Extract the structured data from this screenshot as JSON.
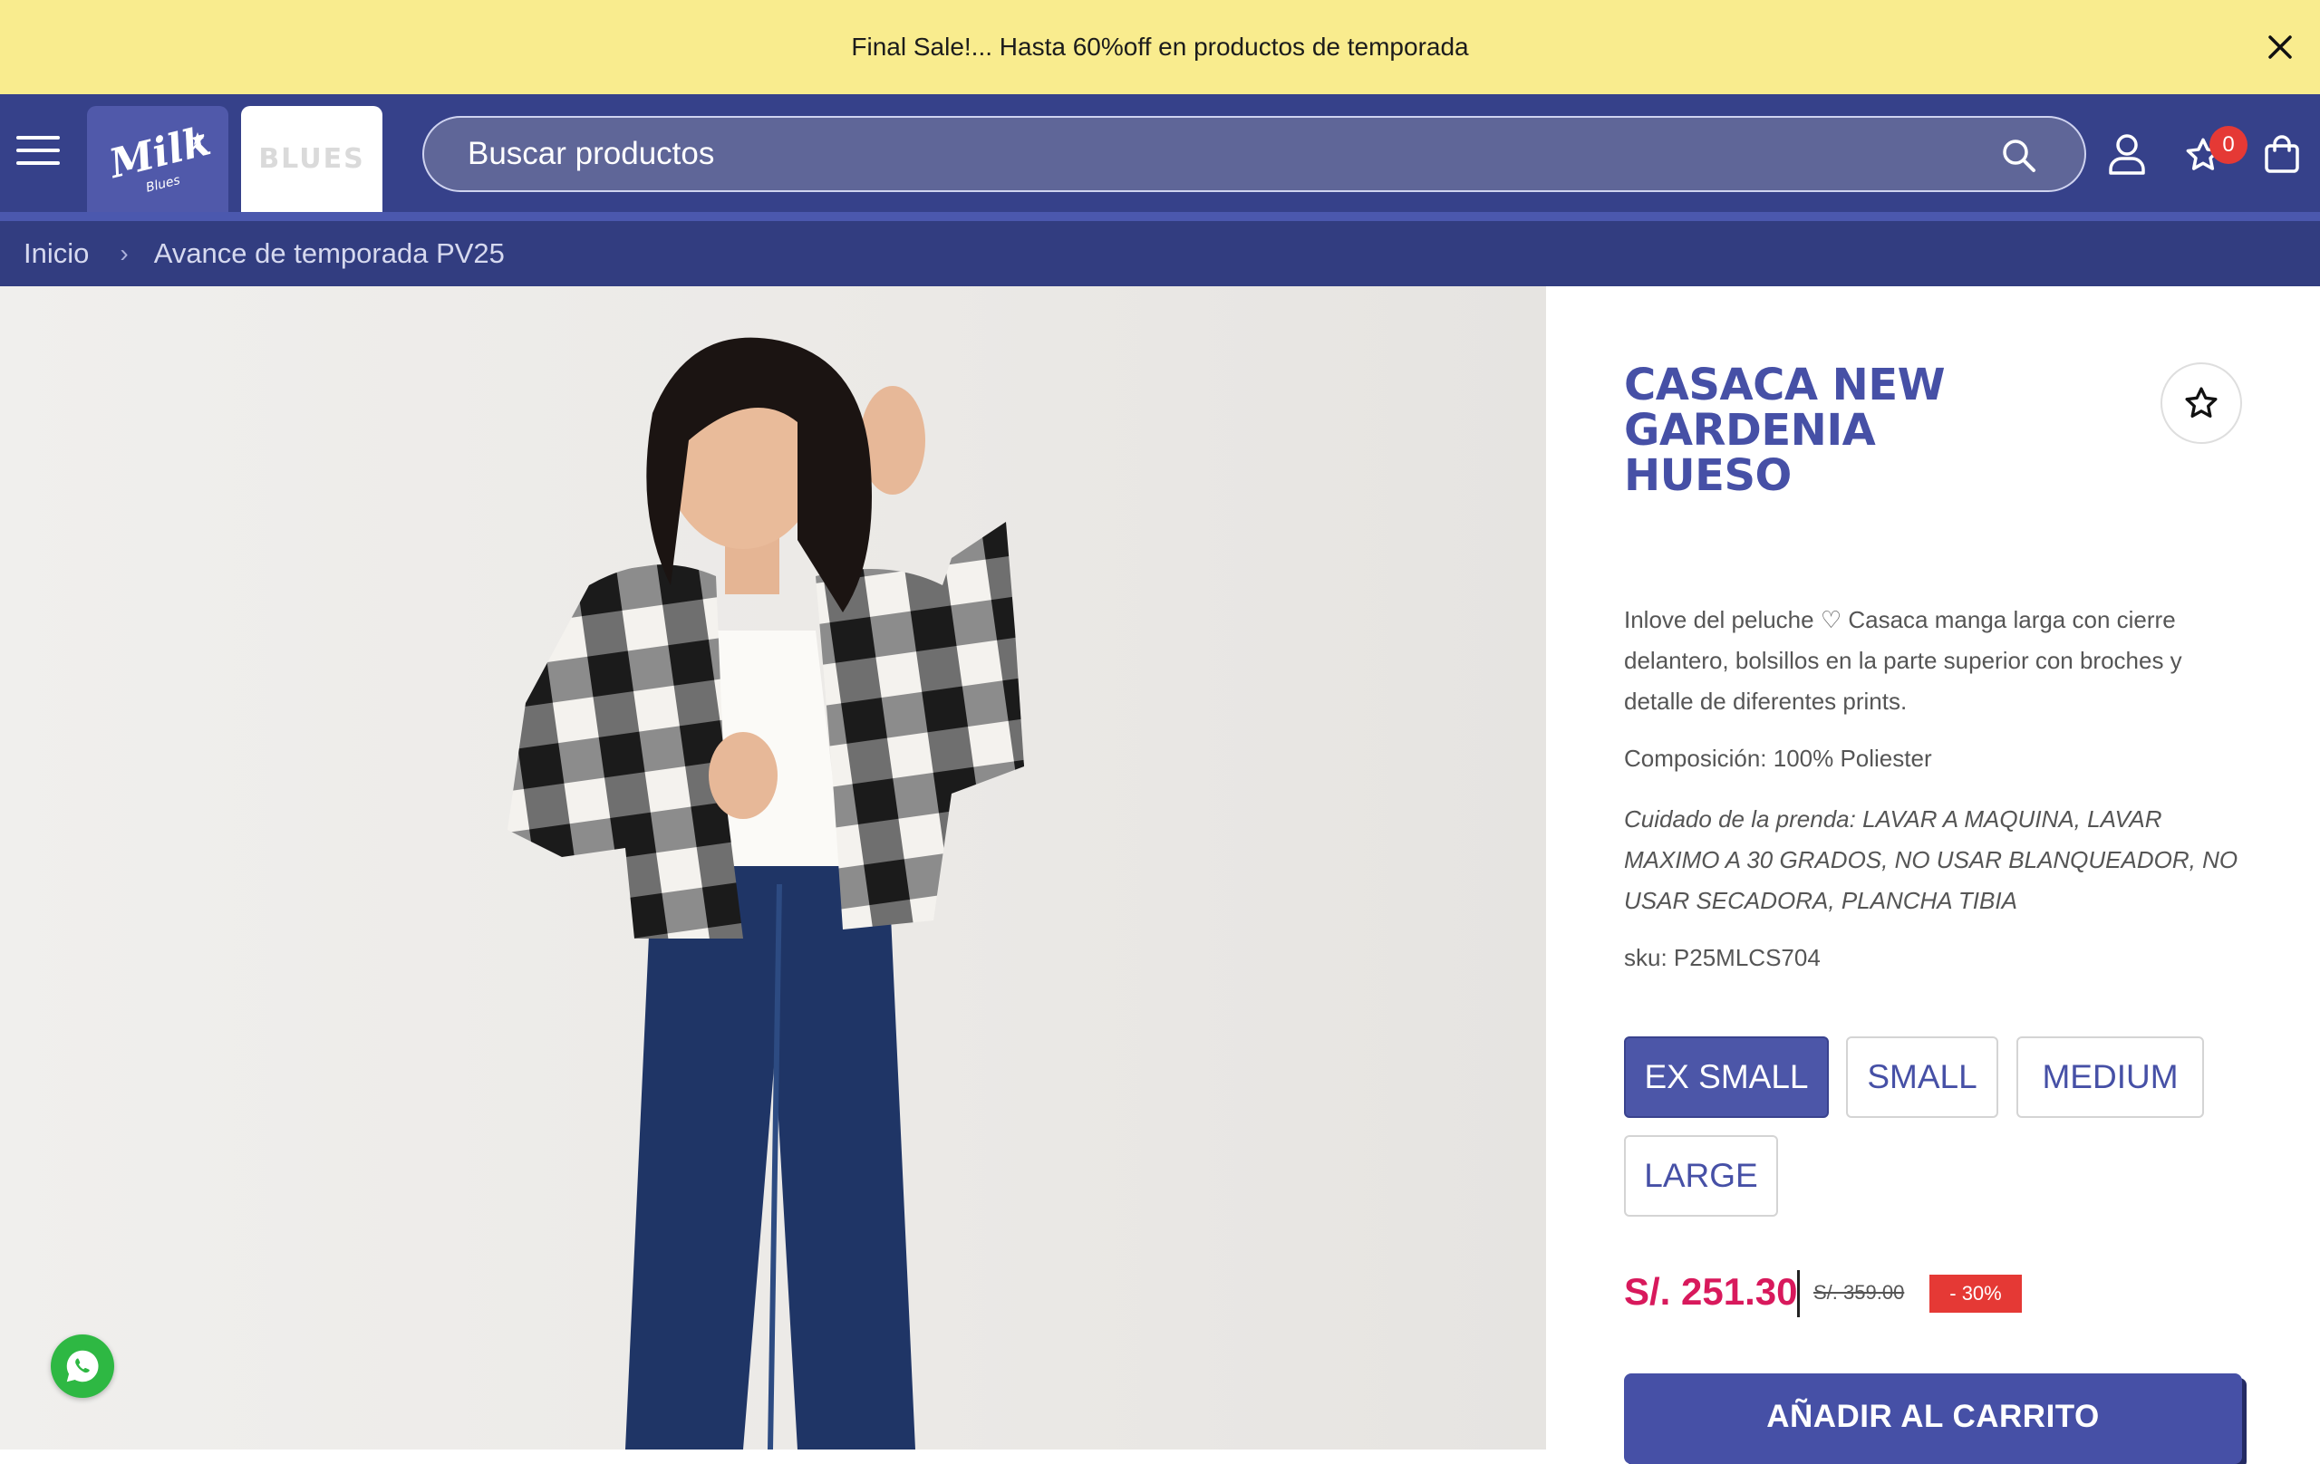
{
  "announcement": {
    "text": "Final Sale!... Hasta 60%off en productos de temporada"
  },
  "header": {
    "brands": {
      "primary": "Milk",
      "primary_sub": "Blues",
      "secondary": "BLUES"
    },
    "search": {
      "placeholder": "Buscar productos"
    },
    "wishlist_count": "0",
    "icons": [
      "menu-icon",
      "search-icon",
      "user-icon",
      "star-icon",
      "shopping-bag-icon"
    ]
  },
  "breadcrumb": {
    "items": [
      "Inicio",
      "Avance de temporada PV25"
    ]
  },
  "product": {
    "title": "CASACA NEW GARDENIA HUESO",
    "description": "Inlove del peluche ♡ Casaca manga larga con cierre delantero, bolsillos en la parte superior con broches y detalle de diferentes prints.",
    "composition": "Composición: 100% Poliester",
    "care": "Cuidado de la prenda:  LAVAR A MAQUINA, LAVAR MAXIMO A 30 GRADOS, NO USAR BLANQUEADOR, NO USAR SECADORA, PLANCHA TIBIA",
    "sku": "sku: P25MLCS704",
    "sizes": [
      "EX SMALL",
      "SMALL",
      "MEDIUM",
      "LARGE"
    ],
    "selected_size": "EX SMALL",
    "price": "S/. 251.30",
    "old_price": "S/. 359.00",
    "discount": "- 30%",
    "add_to_cart": "AÑADIR AL CARRITO"
  },
  "colors": {
    "announcement_bg": "#f9ec8e",
    "header_bg": "#36418a",
    "accent": "#4650a6",
    "price": "#d8195c",
    "discount_bg": "#e53935",
    "whatsapp": "#2eb843"
  }
}
